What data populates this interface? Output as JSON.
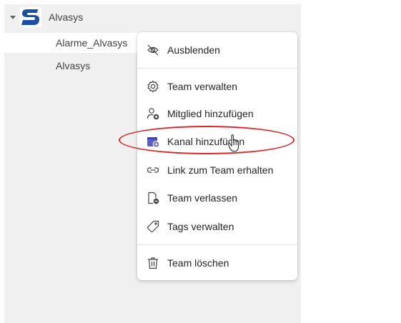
{
  "sidebar": {
    "team": {
      "name": "Alvasys",
      "logo": "alvasys-logo",
      "expand_icon": "caret-down-icon"
    },
    "channels": [
      {
        "label": "Alarme_Alvasys",
        "selected": true
      },
      {
        "label": "Alvasys",
        "selected": false
      }
    ]
  },
  "context_menu": {
    "items": [
      {
        "label": "Ausblenden",
        "icon": "hide-eye-icon"
      },
      {
        "label": "Team verwalten",
        "icon": "gear-icon"
      },
      {
        "label": "Mitglied hinzufügen",
        "icon": "add-person-icon"
      },
      {
        "label": "Kanal hinzufügen",
        "icon": "add-channel-icon"
      },
      {
        "label": "Link zum Team erhalten",
        "icon": "link-icon"
      },
      {
        "label": "Team verlassen",
        "icon": "leave-team-icon"
      },
      {
        "label": "Tags verwalten",
        "icon": "tag-icon"
      },
      {
        "label": "Team löschen",
        "icon": "trash-icon"
      }
    ],
    "highlighted_item": "Kanal hinzufügen"
  },
  "colors": {
    "sidebar_bg": "#f0f0f0",
    "logo_blue": "#1f4fa3",
    "annotation_red": "#d9262c",
    "channel_icon_blue": "#5b5fc7"
  }
}
